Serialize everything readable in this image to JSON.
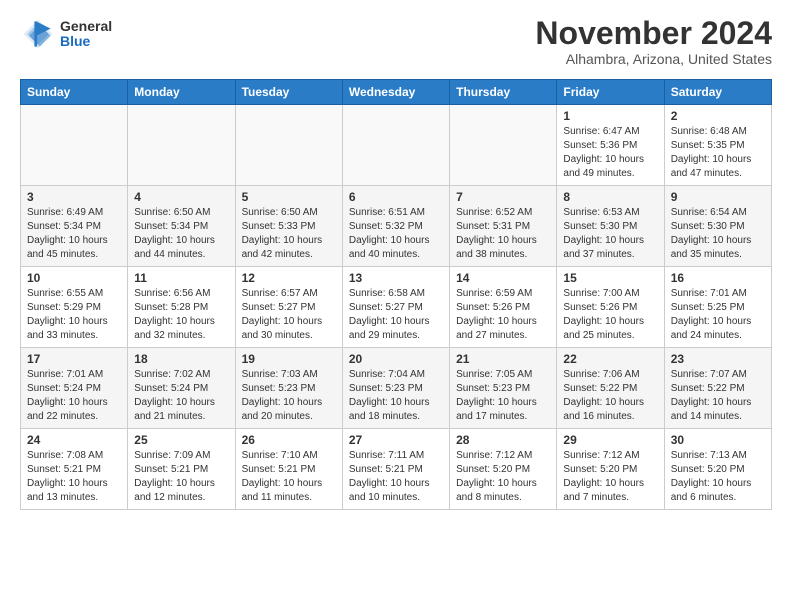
{
  "header": {
    "logo_general": "General",
    "logo_blue": "Blue",
    "month_title": "November 2024",
    "location": "Alhambra, Arizona, United States"
  },
  "weekdays": [
    "Sunday",
    "Monday",
    "Tuesday",
    "Wednesday",
    "Thursday",
    "Friday",
    "Saturday"
  ],
  "weeks": [
    [
      {
        "day": "",
        "info": ""
      },
      {
        "day": "",
        "info": ""
      },
      {
        "day": "",
        "info": ""
      },
      {
        "day": "",
        "info": ""
      },
      {
        "day": "",
        "info": ""
      },
      {
        "day": "1",
        "info": "Sunrise: 6:47 AM\nSunset: 5:36 PM\nDaylight: 10 hours\nand 49 minutes."
      },
      {
        "day": "2",
        "info": "Sunrise: 6:48 AM\nSunset: 5:35 PM\nDaylight: 10 hours\nand 47 minutes."
      }
    ],
    [
      {
        "day": "3",
        "info": "Sunrise: 6:49 AM\nSunset: 5:34 PM\nDaylight: 10 hours\nand 45 minutes."
      },
      {
        "day": "4",
        "info": "Sunrise: 6:50 AM\nSunset: 5:34 PM\nDaylight: 10 hours\nand 44 minutes."
      },
      {
        "day": "5",
        "info": "Sunrise: 6:50 AM\nSunset: 5:33 PM\nDaylight: 10 hours\nand 42 minutes."
      },
      {
        "day": "6",
        "info": "Sunrise: 6:51 AM\nSunset: 5:32 PM\nDaylight: 10 hours\nand 40 minutes."
      },
      {
        "day": "7",
        "info": "Sunrise: 6:52 AM\nSunset: 5:31 PM\nDaylight: 10 hours\nand 38 minutes."
      },
      {
        "day": "8",
        "info": "Sunrise: 6:53 AM\nSunset: 5:30 PM\nDaylight: 10 hours\nand 37 minutes."
      },
      {
        "day": "9",
        "info": "Sunrise: 6:54 AM\nSunset: 5:30 PM\nDaylight: 10 hours\nand 35 minutes."
      }
    ],
    [
      {
        "day": "10",
        "info": "Sunrise: 6:55 AM\nSunset: 5:29 PM\nDaylight: 10 hours\nand 33 minutes."
      },
      {
        "day": "11",
        "info": "Sunrise: 6:56 AM\nSunset: 5:28 PM\nDaylight: 10 hours\nand 32 minutes."
      },
      {
        "day": "12",
        "info": "Sunrise: 6:57 AM\nSunset: 5:27 PM\nDaylight: 10 hours\nand 30 minutes."
      },
      {
        "day": "13",
        "info": "Sunrise: 6:58 AM\nSunset: 5:27 PM\nDaylight: 10 hours\nand 29 minutes."
      },
      {
        "day": "14",
        "info": "Sunrise: 6:59 AM\nSunset: 5:26 PM\nDaylight: 10 hours\nand 27 minutes."
      },
      {
        "day": "15",
        "info": "Sunrise: 7:00 AM\nSunset: 5:26 PM\nDaylight: 10 hours\nand 25 minutes."
      },
      {
        "day": "16",
        "info": "Sunrise: 7:01 AM\nSunset: 5:25 PM\nDaylight: 10 hours\nand 24 minutes."
      }
    ],
    [
      {
        "day": "17",
        "info": "Sunrise: 7:01 AM\nSunset: 5:24 PM\nDaylight: 10 hours\nand 22 minutes."
      },
      {
        "day": "18",
        "info": "Sunrise: 7:02 AM\nSunset: 5:24 PM\nDaylight: 10 hours\nand 21 minutes."
      },
      {
        "day": "19",
        "info": "Sunrise: 7:03 AM\nSunset: 5:23 PM\nDaylight: 10 hours\nand 20 minutes."
      },
      {
        "day": "20",
        "info": "Sunrise: 7:04 AM\nSunset: 5:23 PM\nDaylight: 10 hours\nand 18 minutes."
      },
      {
        "day": "21",
        "info": "Sunrise: 7:05 AM\nSunset: 5:23 PM\nDaylight: 10 hours\nand 17 minutes."
      },
      {
        "day": "22",
        "info": "Sunrise: 7:06 AM\nSunset: 5:22 PM\nDaylight: 10 hours\nand 16 minutes."
      },
      {
        "day": "23",
        "info": "Sunrise: 7:07 AM\nSunset: 5:22 PM\nDaylight: 10 hours\nand 14 minutes."
      }
    ],
    [
      {
        "day": "24",
        "info": "Sunrise: 7:08 AM\nSunset: 5:21 PM\nDaylight: 10 hours\nand 13 minutes."
      },
      {
        "day": "25",
        "info": "Sunrise: 7:09 AM\nSunset: 5:21 PM\nDaylight: 10 hours\nand 12 minutes."
      },
      {
        "day": "26",
        "info": "Sunrise: 7:10 AM\nSunset: 5:21 PM\nDaylight: 10 hours\nand 11 minutes."
      },
      {
        "day": "27",
        "info": "Sunrise: 7:11 AM\nSunset: 5:21 PM\nDaylight: 10 hours\nand 10 minutes."
      },
      {
        "day": "28",
        "info": "Sunrise: 7:12 AM\nSunset: 5:20 PM\nDaylight: 10 hours\nand 8 minutes."
      },
      {
        "day": "29",
        "info": "Sunrise: 7:12 AM\nSunset: 5:20 PM\nDaylight: 10 hours\nand 7 minutes."
      },
      {
        "day": "30",
        "info": "Sunrise: 7:13 AM\nSunset: 5:20 PM\nDaylight: 10 hours\nand 6 minutes."
      }
    ]
  ]
}
